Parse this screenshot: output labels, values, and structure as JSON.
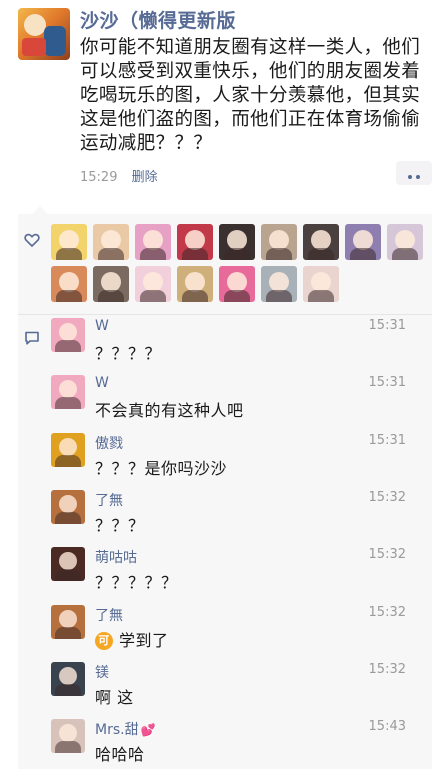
{
  "post": {
    "author": "沙沙（懒得更新版",
    "lines": [
      "你可能不知道朋友圈有这样一类人，他们",
      "可以感受到双重快乐，他们的朋友圈发着",
      "吃喝玩乐的图，人家十分羡慕他，但其实",
      "这是他们盗的图，而他们正在体育场偷偷",
      "运动减肥？？？"
    ],
    "time": "15:29",
    "delete_label": "删除"
  },
  "colors": {
    "link": "#576b95",
    "panel_bg": "#f7f7f7",
    "meta_gray": "#9a9a9a"
  },
  "likes": {
    "icon": "heart-outline-icon",
    "avatars": [
      {
        "color": "#f3d36b"
      },
      {
        "color": "#e9c9a6"
      },
      {
        "color": "#e7a1c4"
      },
      {
        "color": "#c2394a"
      },
      {
        "color": "#3b3030"
      },
      {
        "color": "#b9a490"
      },
      {
        "color": "#4a4040"
      },
      {
        "color": "#8f7fb0"
      },
      {
        "color": "#d5c6d8"
      },
      {
        "color": "#d98a5a"
      },
      {
        "color": "#7a6a60"
      },
      {
        "color": "#f1d0dc"
      },
      {
        "color": "#d0b07a"
      },
      {
        "color": "#e86a9a"
      },
      {
        "color": "#a8b0b8"
      },
      {
        "color": "#e9d4d0"
      }
    ]
  },
  "comments": {
    "icon": "comment-bubble-icon",
    "items": [
      {
        "name": "W",
        "time": "15:31",
        "text": "？？？？",
        "avatar_color": "#f1a9bf"
      },
      {
        "name": "W",
        "time": "15:31",
        "text": "不会真的有这种人吧",
        "avatar_color": "#f1a9bf"
      },
      {
        "name": "傲戮",
        "time": "15:31",
        "text": "？？？是你吗沙沙",
        "avatar_color": "#e0a020"
      },
      {
        "name": "了無",
        "time": "15:32",
        "text": "？？？",
        "avatar_color": "#b5703d"
      },
      {
        "name": "萌咕咕",
        "time": "15:32",
        "text": "？？？？？",
        "avatar_color": "#4a2a22"
      },
      {
        "name": "了無",
        "time": "15:32",
        "text": "学到了",
        "emoji": "可",
        "avatar_color": "#b5703d"
      },
      {
        "name": "镁",
        "time": "15:32",
        "text": "啊 这",
        "avatar_color": "#39424f"
      },
      {
        "name": "Mrs.甜",
        "time": "15:43",
        "text": "哈哈哈",
        "badge": "💕",
        "avatar_color": "#d8c3bb"
      }
    ]
  }
}
